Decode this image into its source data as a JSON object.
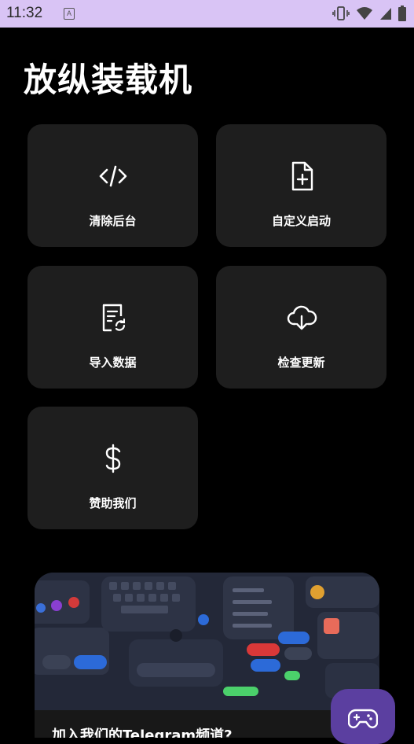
{
  "status_bar": {
    "time": "11:32",
    "notification_icon": "a-icon",
    "icons": [
      "vibrate-icon",
      "wifi-icon",
      "signal-icon",
      "battery-icon"
    ]
  },
  "app": {
    "title": "放纵装载机"
  },
  "cards": [
    {
      "label": "清除后台",
      "icon": "code-icon"
    },
    {
      "label": "自定义启动",
      "icon": "file-add-icon"
    },
    {
      "label": "导入数据",
      "icon": "document-sync-icon"
    },
    {
      "label": "检查更新",
      "icon": "cloud-download-icon"
    },
    {
      "label": "赞助我们",
      "icon": "dollar-icon"
    }
  ],
  "banner": {
    "caption": "加入我们的Telegram频道?"
  },
  "fab": {
    "icon": "gamepad-icon"
  },
  "colors": {
    "status_bar": "#d9c4f5",
    "card": "#1e1e1e",
    "fab": "#5b3fa0",
    "background": "#000000"
  }
}
